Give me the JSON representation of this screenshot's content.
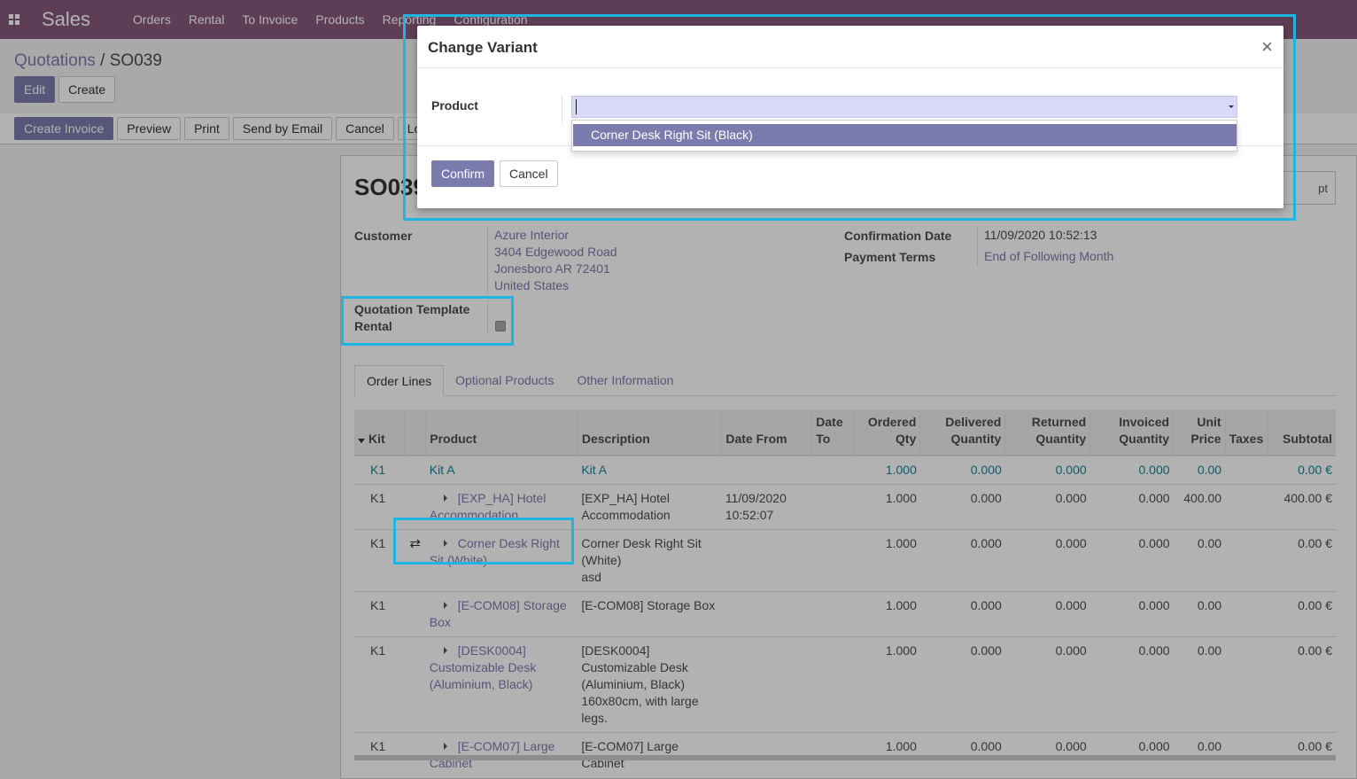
{
  "navbar": {
    "app_name": "Sales",
    "menu": [
      "Orders",
      "Rental",
      "To Invoice",
      "Products",
      "Reporting",
      "Configuration"
    ]
  },
  "breadcrumb": {
    "parent": "Quotations",
    "separator": " / ",
    "current": "SO039"
  },
  "control_buttons": {
    "edit": "Edit",
    "create": "Create"
  },
  "statusbar_buttons": [
    "Create Invoice",
    "Preview",
    "Print",
    "Send by Email",
    "Cancel",
    "Lock"
  ],
  "sheet": {
    "title": "SO039",
    "ghost_button": "pt",
    "customer_label": "Customer",
    "customer_lines": [
      "Azure Interior",
      "3404 Edgewood Road",
      "Jonesboro AR 72401",
      "United States"
    ],
    "confirmation_date_label": "Confirmation Date",
    "confirmation_date": "11/09/2020 10:52:13",
    "payment_terms_label": "Payment Terms",
    "payment_terms": "End of Following Month",
    "qt_rental_label_1": "Quotation Template",
    "qt_rental_label_2": "Rental",
    "qt_rental_checked": true
  },
  "tabs": [
    "Order Lines",
    "Optional Products",
    "Other Information"
  ],
  "table": {
    "headers": {
      "kit": "Kit",
      "product": "Product",
      "description": "Description",
      "date_from": "Date From",
      "date_to_1": "Date",
      "date_to_2": "To",
      "ordered_1": "Ordered",
      "ordered_2": "Qty",
      "delivered_1": "Delivered",
      "delivered_2": "Quantity",
      "returned_1": "Returned",
      "returned_2": "Quantity",
      "invoiced_1": "Invoiced",
      "invoiced_2": "Quantity",
      "unit_1": "Unit",
      "unit_2": "Price",
      "taxes": "Taxes",
      "subtotal": "Subtotal"
    },
    "section": {
      "kit": "K1",
      "product": "Kit A",
      "description": "Kit A",
      "ordered": "1.000",
      "delivered": "0.000",
      "returned": "0.000",
      "invoiced": "0.000",
      "unit_price": "0.00",
      "subtotal": "0.00 €"
    },
    "rows": [
      {
        "kit": "K1",
        "product_1": "[EXP_HA] Hotel",
        "product_2": "Accommodation",
        "desc_1": "[EXP_HA] Hotel",
        "desc_2": "Accommodation",
        "date_from_1": "11/09/2020",
        "date_from_2": "10:52:07",
        "ordered": "1.000",
        "delivered": "0.000",
        "returned": "0.000",
        "invoiced": "0.000",
        "unit_price": "400.00",
        "subtotal": "400.00 €"
      },
      {
        "kit": "K1",
        "product_1": "Corner Desk Right",
        "product_2": "Sit (White)",
        "desc_1": "Corner Desk Right Sit",
        "desc_2": "(White)",
        "desc_3": "asd",
        "ordered": "1.000",
        "delivered": "0.000",
        "returned": "0.000",
        "invoiced": "0.000",
        "unit_price": "0.00",
        "subtotal": "0.00 €"
      },
      {
        "kit": "K1",
        "product_1": "[E-COM08] Storage",
        "product_2": "Box",
        "desc_1": "[E-COM08] Storage Box",
        "ordered": "1.000",
        "delivered": "0.000",
        "returned": "0.000",
        "invoiced": "0.000",
        "unit_price": "0.00",
        "subtotal": "0.00 €"
      },
      {
        "kit": "K1",
        "product_1": "[DESK0004]",
        "product_2": "Customizable Desk",
        "product_3": "(Aluminium, Black)",
        "desc_1": "[DESK0004]",
        "desc_2": "Customizable Desk",
        "desc_3": "(Aluminium, Black)",
        "desc_4": "160x80cm, with large",
        "desc_5": "legs.",
        "ordered": "1.000",
        "delivered": "0.000",
        "returned": "0.000",
        "invoiced": "0.000",
        "unit_price": "0.00",
        "subtotal": "0.00 €"
      },
      {
        "kit": "K1",
        "product_1": "[E-COM07] Large",
        "product_2": "Cabinet",
        "desc_1": "[E-COM07] Large",
        "desc_2": "Cabinet",
        "ordered": "1.000",
        "delivered": "0.000",
        "returned": "0.000",
        "invoiced": "0.000",
        "unit_price": "0.00",
        "subtotal": "0.00 €"
      }
    ]
  },
  "modal": {
    "title": "Change Variant",
    "close_glyph": "×",
    "product_label": "Product",
    "product_value": "",
    "dropdown_option": "Corner Desk Right Sit (Black)",
    "confirm": "Confirm",
    "cancel": "Cancel"
  },
  "colors": {
    "brand": "#875a7b",
    "primary": "#7c7bad",
    "highlight": "#1fb5e3",
    "section_text": "#138496"
  }
}
